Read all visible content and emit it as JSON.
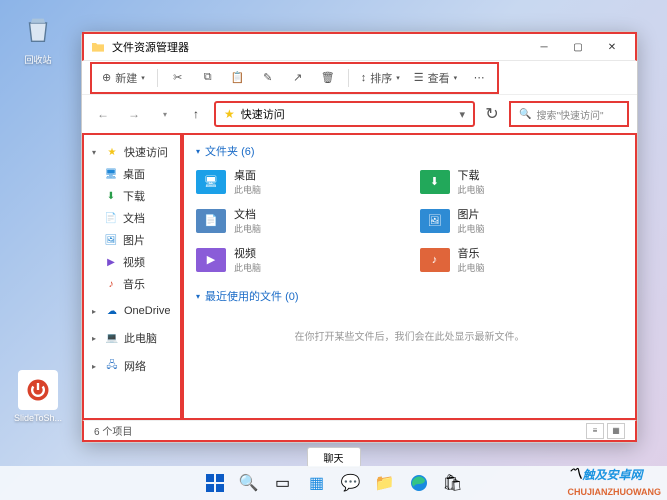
{
  "desktop": {
    "icon1_label": "回收站",
    "icon2_label": "SlideToSh..."
  },
  "window": {
    "title": "文件资源管理器",
    "toolbar": {
      "new": "新建",
      "sort": "排序",
      "view": "查看"
    },
    "address": {
      "label": "快速访问"
    },
    "search": {
      "placeholder": "搜索\"快速访问\""
    },
    "sidebar": {
      "quick": "快速访问",
      "desktop": "桌面",
      "downloads": "下载",
      "documents": "文档",
      "pictures": "图片",
      "videos": "视频",
      "music": "音乐",
      "onedrive": "OneDrive",
      "thispc": "此电脑",
      "network": "网络"
    },
    "content": {
      "folders_header": "文件夹 (6)",
      "sub": "此电脑",
      "f_desktop": "桌面",
      "f_downloads": "下载",
      "f_documents": "文档",
      "f_pictures": "图片",
      "f_videos": "视频",
      "f_music": "音乐",
      "recent_header": "最近使用的文件 (0)",
      "recent_empty": "在你打开某些文件后，我们会在此处显示最新文件。"
    },
    "status": {
      "count": "6 个项目"
    }
  },
  "chat_label": "聊天",
  "watermark": {
    "main": "触及安卓网",
    "sub": "CHUJIANZHUOWANG"
  }
}
